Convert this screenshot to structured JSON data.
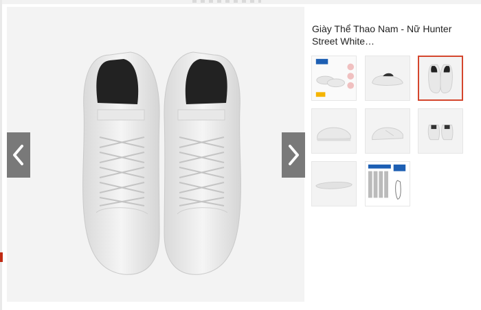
{
  "product": {
    "title": "Giày Thể Thao Nam - Nữ Hunter Street White…"
  },
  "gallery": {
    "selected_index": 2,
    "thumbnails": [
      {
        "name": "thumbnail-promo"
      },
      {
        "name": "thumbnail-front-angle"
      },
      {
        "name": "thumbnail-top-view"
      },
      {
        "name": "thumbnail-side-view"
      },
      {
        "name": "thumbnail-side-view-2"
      },
      {
        "name": "thumbnail-back-view"
      },
      {
        "name": "thumbnail-sole"
      },
      {
        "name": "thumbnail-size-chart"
      }
    ]
  },
  "colors": {
    "accent": "#d4452c",
    "nav_button": "#6f6f6f"
  }
}
